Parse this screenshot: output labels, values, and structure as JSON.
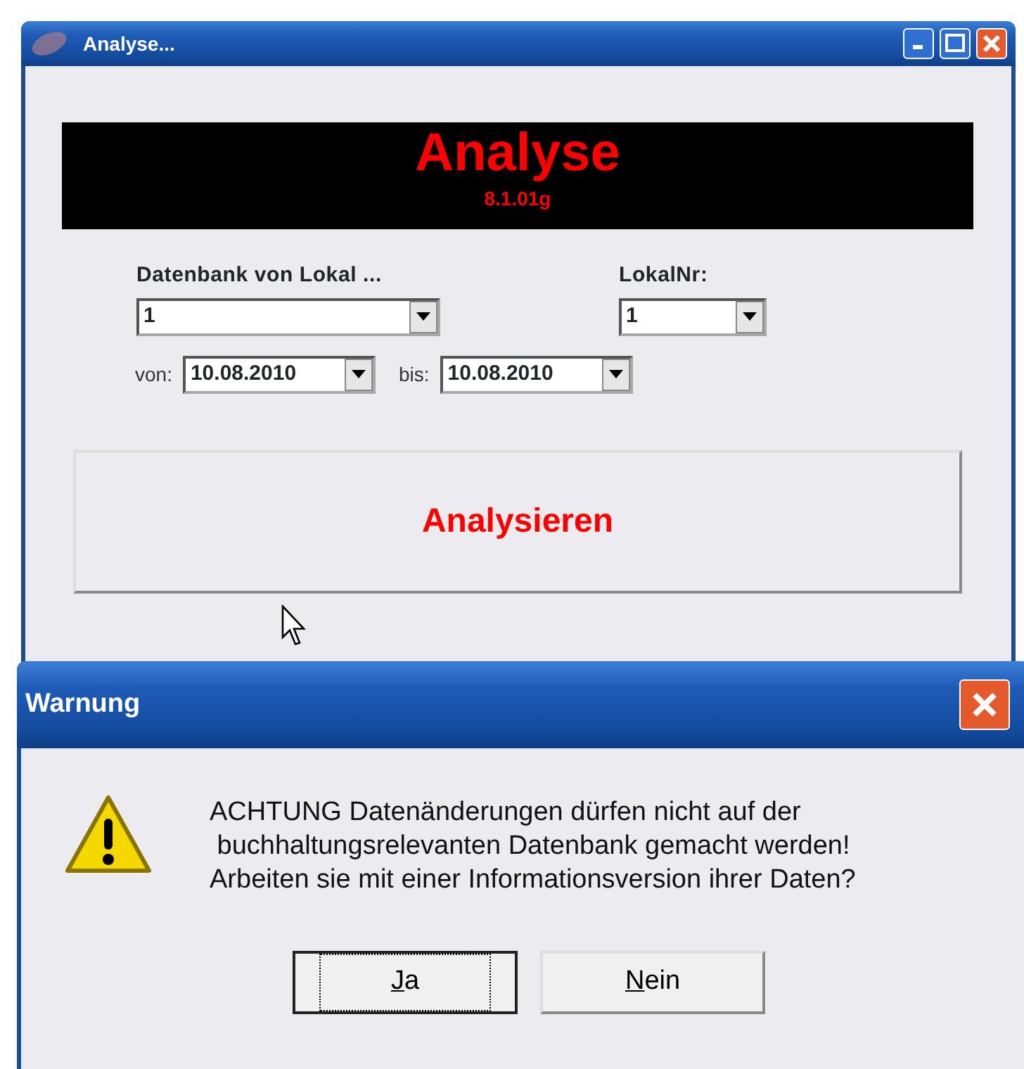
{
  "main_window": {
    "title": "Analyse...",
    "banner": {
      "title": "Analyse",
      "version": "8.1.01g"
    },
    "fields": [
      {
        "label": "Datenbank von Lokal ...",
        "value": "1",
        "kind": "wide"
      },
      {
        "label": "LokalNr:",
        "value": "1",
        "kind": "narrow"
      }
    ],
    "date_range": [
      {
        "label": "von:",
        "value": "10.08.2010"
      },
      {
        "label": "bis:",
        "value": "10.08.2010"
      }
    ],
    "action_button": "Analysieren"
  },
  "dialog": {
    "title": "Warnung",
    "message_lines": [
      "ACHTUNG Datenänderungen dürfen nicht auf der",
      " buchhaltungsrelevanten Datenbank gemacht werden!",
      "Arbeiten sie mit einer Informationsversion ihrer Daten?"
    ],
    "buttons": [
      {
        "label": "Ja",
        "focused": true
      },
      {
        "label": "Nein",
        "focused": false
      }
    ]
  }
}
